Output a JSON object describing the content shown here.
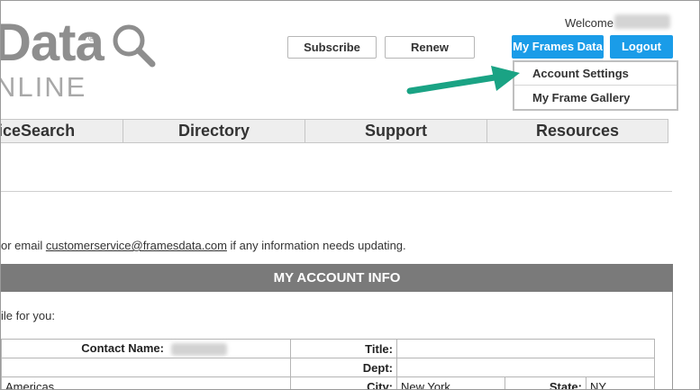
{
  "logo": {
    "top_text": "Data",
    "registered": "®",
    "bottom_text": "NLINE"
  },
  "header": {
    "welcome_label": "Welcome",
    "subscribe_label": "Subscribe",
    "renew_label": "Renew",
    "my_frames_label": "My Frames Data",
    "logout_label": "Logout"
  },
  "dropdown": {
    "items": [
      {
        "label": "Account Settings"
      },
      {
        "label": "My Frame Gallery"
      }
    ]
  },
  "nav": {
    "items": [
      {
        "label": "iceSearch"
      },
      {
        "label": "Directory"
      },
      {
        "label": "Support"
      },
      {
        "label": "Resources"
      }
    ]
  },
  "content": {
    "email_prefix": "or email ",
    "email": "customerservice@framesdata.com",
    "email_suffix": " if any information needs updating.",
    "section_title": "MY ACCOUNT INFO",
    "intro": "ile for you:"
  },
  "account_table": {
    "contact_label": "Contact Name:",
    "title_label": "Title:",
    "dept_label": "Dept:",
    "region_value": "Americas",
    "city_label": "City:",
    "city_value": "New York",
    "state_label": "State:",
    "state_value": "NY"
  },
  "colors": {
    "accent_blue": "#1a9ce8",
    "arrow_green": "#1aa384",
    "section_gray": "#7a7a7a",
    "nav_gray": "#eeeeee"
  }
}
